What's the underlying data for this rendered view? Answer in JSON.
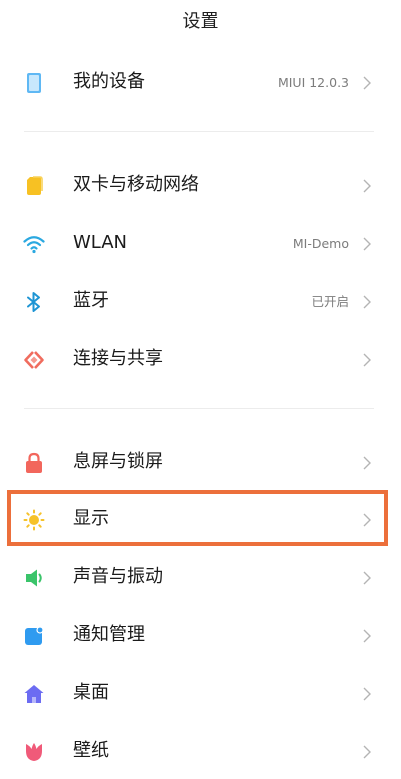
{
  "header": {
    "title": "设置"
  },
  "items": [
    {
      "key": "device",
      "label": "我的设备",
      "value": "MIUI 12.0.3",
      "icon": "phone-icon",
      "color": "#3fa9f5"
    },
    {
      "key": "sim",
      "label": "双卡与移动网络",
      "value": "",
      "icon": "sim-card-icon",
      "color": "#f7c123"
    },
    {
      "key": "wlan",
      "label": "WLAN",
      "value": "MI-Demo",
      "icon": "wifi-icon",
      "color": "#2aa8e0"
    },
    {
      "key": "bluetooth",
      "label": "蓝牙",
      "value": "已开启",
      "icon": "bluetooth-icon",
      "color": "#1e95d4"
    },
    {
      "key": "share",
      "label": "连接与共享",
      "value": "",
      "icon": "connection-share-icon",
      "color": "#f06c5e"
    },
    {
      "key": "lock",
      "label": "息屏与锁屏",
      "value": "",
      "icon": "lock-icon",
      "color": "#f2665c"
    },
    {
      "key": "display",
      "label": "显示",
      "value": "",
      "icon": "sun-icon",
      "color": "#f6c229"
    },
    {
      "key": "sound",
      "label": "声音与振动",
      "value": "",
      "icon": "speaker-icon",
      "color": "#3ac46a"
    },
    {
      "key": "notify",
      "label": "通知管理",
      "value": "",
      "icon": "notification-icon",
      "color": "#2f9bf0"
    },
    {
      "key": "home",
      "label": "桌面",
      "value": "",
      "icon": "home-icon",
      "color": "#6c6cf2"
    },
    {
      "key": "wallpaper",
      "label": "壁纸",
      "value": "",
      "icon": "flower-icon",
      "color": "#f05a79"
    }
  ],
  "highlight_color": "#ec6f3b",
  "highlighted_item": "display"
}
